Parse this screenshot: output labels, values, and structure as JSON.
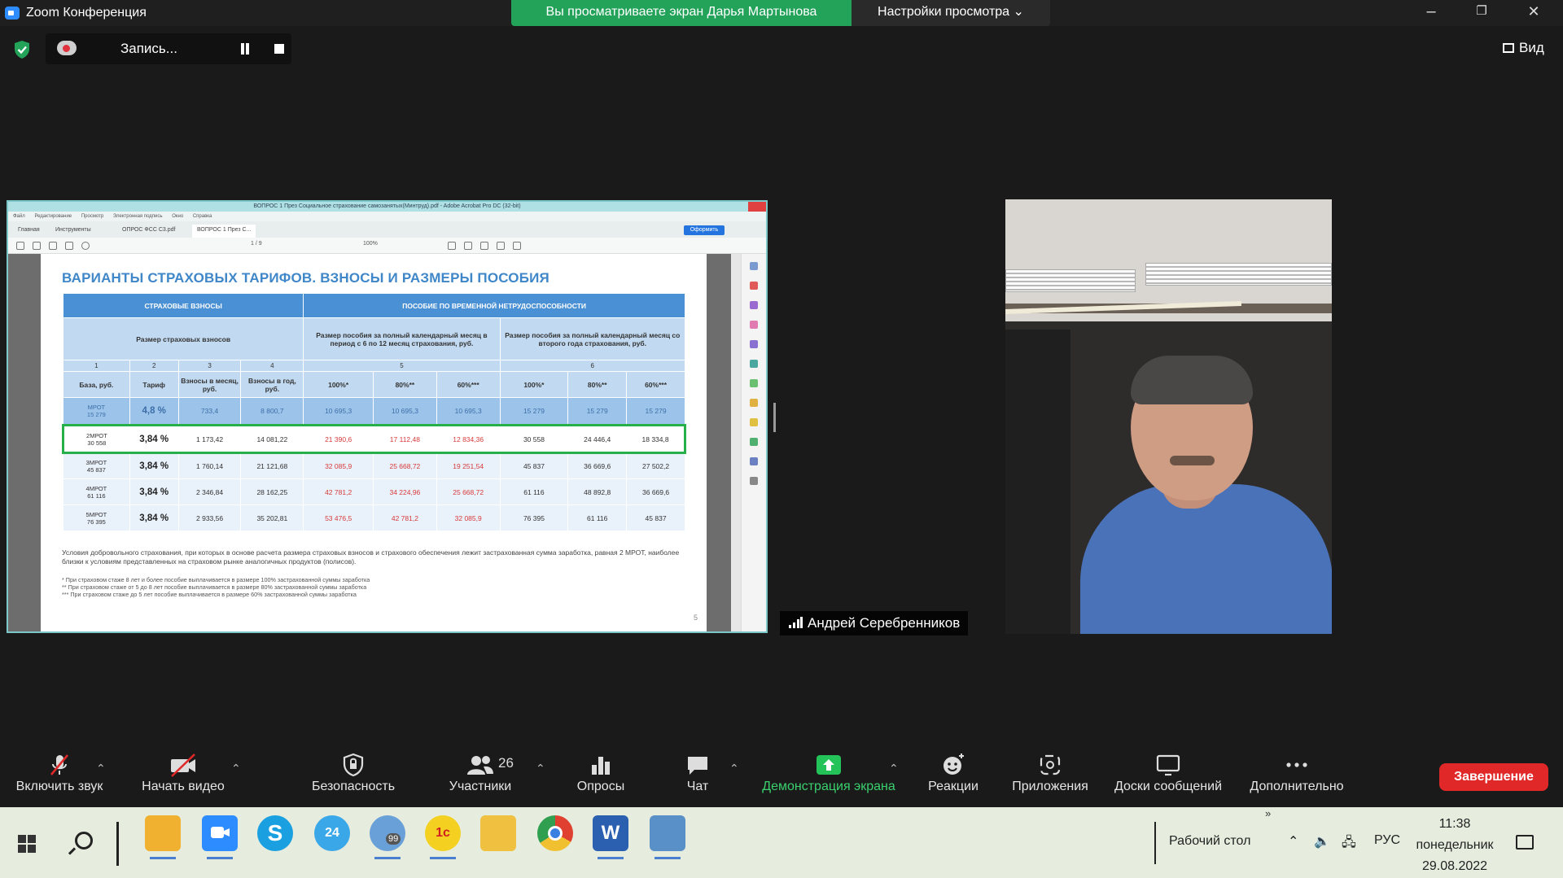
{
  "window": {
    "title": "Zoom Конференция",
    "share_banner": "Вы просматриваете экран Дарья Мартынова",
    "view_options": "Настройки просмотра",
    "minimize": "–",
    "maximize": "❐",
    "close": "✕"
  },
  "recording": {
    "label": "Запись..."
  },
  "view_button": "Вид",
  "acrobat": {
    "title": "ВОПРОС 1 През Социальное страхование самозанятых(Минтруд).pdf - Adobe Acrobat Pro DC (32-bit)",
    "menu": [
      "Файл",
      "Редактирование",
      "Просмотр",
      "Электронная подпись",
      "Окно",
      "Справка"
    ],
    "tabs": [
      "Главная",
      "Инструменты",
      "ОПРОС ФСС С3.pdf",
      "ВОПРОС 1 През С..."
    ],
    "publish_button": "Оформить",
    "page_indicator": "1 / 9",
    "zoom": "100%"
  },
  "slide": {
    "title": "ВАРИАНТЫ СТРАХОВЫХ ТАРИФОВ. ВЗНОСЫ И РАЗМЕРЫ ПОСОБИЯ",
    "group_insurance": "СТРАХОВЫЕ ВЗНОСЫ",
    "group_benefit": "ПОСОБИЕ ПО ВРЕМЕННОЙ НЕТРУДОСПОСОБНОСТИ",
    "sub_insurance": "Размер страховых взносов",
    "sub_benefit_1": "Размер пособия за полный календарный месяц в период с 6 по 12 месяц страхования, руб.",
    "sub_benefit_2": "Размер пособия за полный календарный месяц со второго года страхования, руб.",
    "col_numbers": [
      "1",
      "2",
      "3",
      "4",
      "5",
      "6"
    ],
    "columns": [
      "База, руб.",
      "Тариф",
      "Взносы в месяц, руб.",
      "Взносы в год, руб.",
      "100%*",
      "80%**",
      "60%***",
      "100%*",
      "80%**",
      "60%***"
    ],
    "rows": [
      {
        "base_a": "МРОТ",
        "base_b": "15 279",
        "cells": [
          "4,8 %",
          "733,4",
          "8 800,7",
          "10 695,3",
          "10 695,3",
          "10 695,3",
          "15 279",
          "15 279",
          "15 279"
        ]
      },
      {
        "base_a": "2МРОТ",
        "base_b": "30 558",
        "cells": [
          "3,84 %",
          "1 173,42",
          "14 081,22",
          "21 390,6",
          "17 112,48",
          "12 834,36",
          "30 558",
          "24 446,4",
          "18 334,8"
        ]
      },
      {
        "base_a": "3МРОТ",
        "base_b": "45 837",
        "cells": [
          "3,84 %",
          "1 760,14",
          "21 121,68",
          "32 085,9",
          "25 668,72",
          "19 251,54",
          "45 837",
          "36 669,6",
          "27 502,2"
        ]
      },
      {
        "base_a": "4МРОТ",
        "base_b": "61 116",
        "cells": [
          "3,84 %",
          "2 346,84",
          "28 162,25",
          "42 781,2",
          "34 224,96",
          "25 668,72",
          "61 116",
          "48 892,8",
          "36 669,6"
        ]
      },
      {
        "base_a": "5МРОТ",
        "base_b": "76 395",
        "cells": [
          "3,84 %",
          "2 933,56",
          "35 202,81",
          "53 476,5",
          "42 781,2",
          "32 085,9",
          "76 395",
          "61 116",
          "45 837"
        ]
      }
    ],
    "note": "Условия добровольного страхования, при которых в основе расчета размера страховых взносов и страхового обеспечения лежит застрахованная сумма заработка, равная 2 МРОТ, наиболее близки к условиям представленных на страховом рынке аналогичных продуктов (полисов).",
    "footnotes": [
      "* При страховом стаже 8 лет и более пособие выплачивается в размере 100% застрахованной суммы заработка",
      "** При страховом стаже от 5 до 8 лет пособие выплачивается в размере 80% застрахованной суммы заработка",
      "*** При страховом стаже до 5 лет пособие выплачивается в размере 60% застрахованной суммы заработка"
    ],
    "page_number": "5"
  },
  "participant": {
    "name": "Андрей Серебренников"
  },
  "toolbar": {
    "unmute": "Включить звук",
    "start_video": "Начать видео",
    "security": "Безопасность",
    "participants": "Участники",
    "participants_count": "26",
    "polls": "Опросы",
    "chat": "Чат",
    "share_screen": "Демонстрация экрана",
    "reactions": "Реакции",
    "apps": "Приложения",
    "whiteboards": "Доски сообщений",
    "more": "Дополнительно",
    "end": "Завершение"
  },
  "taskbar": {
    "apps": [
      "outlook-icon",
      "zoom-icon",
      "skype-icon",
      "bitrix24-icon",
      "messenger-icon",
      "1c-icon",
      "explorer-icon",
      "chrome-icon",
      "word-icon",
      "remote-desktop-icon"
    ],
    "messenger_badge": "99",
    "desktop": "Рабочий стол",
    "lang": "РУС",
    "time": "11:38",
    "weekday": "понедельник",
    "date": "29.08.2022"
  },
  "colors": {
    "share_green": "#23a35a",
    "end_red": "#e02828",
    "slide_blue": "#4a90d4",
    "highlight_green": "#27b04a"
  }
}
